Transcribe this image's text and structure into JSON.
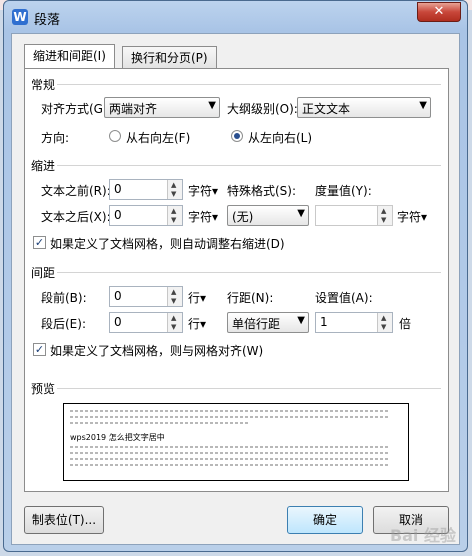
{
  "window": {
    "title": "段落",
    "app_icon_letter": "W",
    "close_glyph": "✕"
  },
  "tabs": [
    {
      "label": "缩进和间距(I)",
      "active": true
    },
    {
      "label": "换行和分页(P)",
      "active": false
    }
  ],
  "general": {
    "heading": "常规",
    "alignment_label": "对齐方式(G):",
    "alignment_value": "两端对齐",
    "outline_label": "大纲级别(O):",
    "outline_value": "正文文本",
    "direction_label": "方向:",
    "rtl_label": "从右向左(F)",
    "ltr_label": "从左向右(L)"
  },
  "indent": {
    "heading": "缩进",
    "before_label": "文本之前(R):",
    "before_value": "0",
    "before_unit": "字符",
    "after_label": "文本之后(X):",
    "after_value": "0",
    "after_unit": "字符",
    "special_label": "特殊格式(S):",
    "special_value": "(无)",
    "measure_label": "度量值(Y):",
    "measure_value": "",
    "measure_unit": "字符",
    "auto_adjust_label": "如果定义了文档网格，则自动调整右缩进(D)"
  },
  "spacing": {
    "heading": "间距",
    "before_label": "段前(B):",
    "before_value": "0",
    "before_unit": "行",
    "after_label": "段后(E):",
    "after_value": "0",
    "after_unit": "行",
    "line_label": "行距(N):",
    "line_value": "单倍行距",
    "setting_label": "设置值(A):",
    "setting_value": "1",
    "setting_unit": "倍",
    "snap_grid_label": "如果定义了文档网格，则与网格对齐(W)"
  },
  "preview": {
    "heading": "预览",
    "sample_text": "wps2019 怎么把文字居中"
  },
  "buttons": {
    "tabs": "制表位(T)...",
    "ok": "确定",
    "cancel": "取消"
  },
  "watermark": "Bai 经验",
  "glyphs": {
    "arrow_down": "▼",
    "arrow_up": "▲",
    "check": "✓",
    "small_down": "▾"
  }
}
